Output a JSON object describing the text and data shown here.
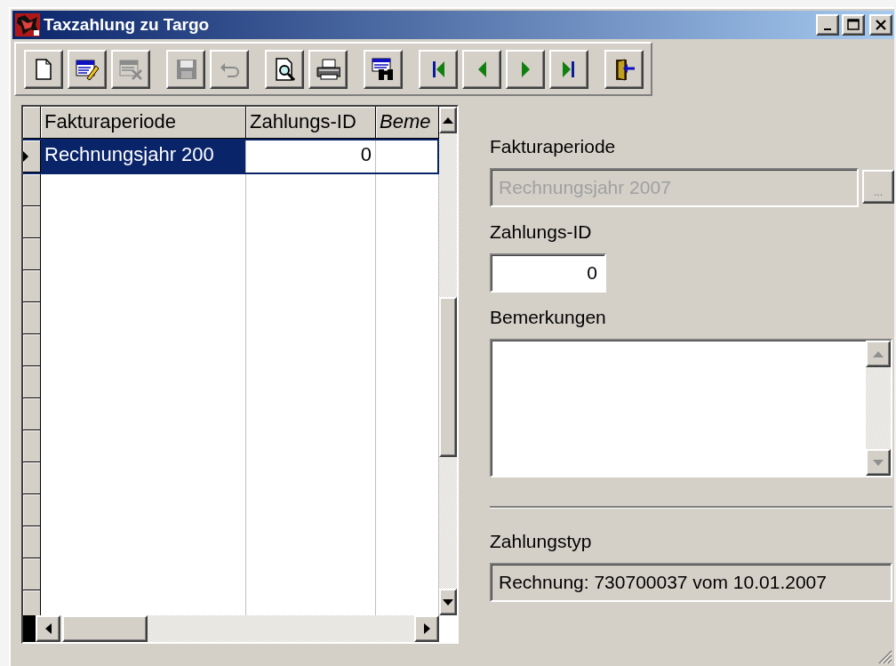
{
  "window": {
    "title": "Taxzahlung zu Targo"
  },
  "toolbar": {
    "groups": [
      [
        {
          "kind": "new",
          "disabled": false
        },
        {
          "kind": "edit",
          "disabled": false
        },
        {
          "kind": "delete",
          "disabled": true
        }
      ],
      [
        {
          "kind": "save",
          "disabled": true
        },
        {
          "kind": "undo",
          "disabled": true
        }
      ],
      [
        {
          "kind": "preview",
          "disabled": false
        },
        {
          "kind": "print",
          "disabled": false
        }
      ],
      [
        {
          "kind": "find",
          "disabled": false
        }
      ],
      [
        {
          "kind": "first",
          "disabled": false
        },
        {
          "kind": "prev",
          "disabled": false
        },
        {
          "kind": "next",
          "disabled": false
        },
        {
          "kind": "last",
          "disabled": false
        }
      ],
      [
        {
          "kind": "exit",
          "disabled": false
        }
      ]
    ]
  },
  "grid": {
    "columns": [
      {
        "label": "Fakturaperiode",
        "italic": false,
        "kind": "text"
      },
      {
        "label": "Zahlungs-ID",
        "italic": false,
        "kind": "number"
      },
      {
        "label": "Beme",
        "italic": true,
        "kind": "text"
      }
    ],
    "rows": [
      {
        "cells": [
          "Rechnungsjahr 200",
          "0"
        ],
        "selected": true
      }
    ]
  },
  "form": {
    "fields": [
      {
        "kind": "lookup",
        "label": "Fakturaperiode",
        "value": "Rechnungsjahr 2007",
        "disabled": true,
        "button": "..."
      },
      {
        "kind": "number",
        "label": "Zahlungs-ID",
        "value": "0",
        "disabled": false
      },
      {
        "kind": "memo",
        "label": "Bemerkungen",
        "disabled": false
      },
      {
        "kind": "separator"
      },
      {
        "kind": "readonly",
        "label": "Zahlungstyp",
        "value": "Rechnung: 730700037 vom 10.01.2007"
      }
    ]
  }
}
